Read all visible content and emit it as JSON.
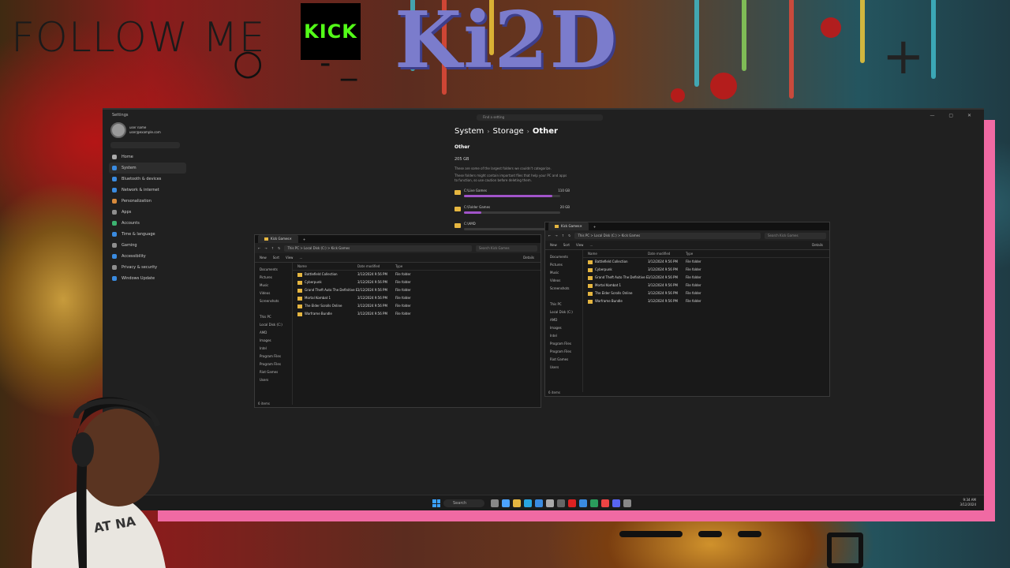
{
  "overlay": {
    "follow_text": "FOLLOW ME",
    "kick_text": "KICK",
    "logo_text": "Ki2D",
    "brand_color": "#53fc18",
    "frame_color": "#f06aa3"
  },
  "settings": {
    "window_title": "Settings",
    "search_placeholder": "Find a setting",
    "account": {
      "name": "user name",
      "email": "user@example.com"
    },
    "nav": [
      {
        "label": "Home",
        "icon": "home-icon",
        "color": "#aaa"
      },
      {
        "label": "System",
        "icon": "monitor-icon",
        "color": "#3a8be0",
        "selected": true
      },
      {
        "label": "Bluetooth & devices",
        "icon": "bluetooth-icon",
        "color": "#3a8be0"
      },
      {
        "label": "Network & internet",
        "icon": "wifi-icon",
        "color": "#3a8be0"
      },
      {
        "label": "Personalization",
        "icon": "brush-icon",
        "color": "#d88a3b"
      },
      {
        "label": "Apps",
        "icon": "apps-icon",
        "color": "#8e8e8e"
      },
      {
        "label": "Accounts",
        "icon": "person-icon",
        "color": "#3cb371"
      },
      {
        "label": "Time & language",
        "icon": "globe-icon",
        "color": "#3a8be0"
      },
      {
        "label": "Gaming",
        "icon": "controller-icon",
        "color": "#8e8e8e"
      },
      {
        "label": "Accessibility",
        "icon": "accessibility-icon",
        "color": "#3a8be0"
      },
      {
        "label": "Privacy & security",
        "icon": "shield-icon",
        "color": "#8e8e8e"
      },
      {
        "label": "Windows Update",
        "icon": "update-icon",
        "color": "#3a8be0"
      }
    ],
    "breadcrumb": {
      "a": "System",
      "b": "Storage",
      "c": "Other"
    },
    "section_title": "Other",
    "total_size": "205 GB",
    "desc1": "These are some of the largest folders we couldn't categorize.",
    "desc2": "These folders might contain important files that help your PC and apps",
    "desc3": "to function, so use caution before deleting them.",
    "rows": [
      {
        "name": "C:\\Live Games",
        "size": "110 GB",
        "fill": 0.92
      },
      {
        "name": "C:\\Folder Games",
        "size": "20 GB",
        "fill": 0.18
      },
      {
        "name": "C:\\AMD",
        "size": "",
        "fill": 0
      }
    ]
  },
  "explorer_left": {
    "tab_title": "Kick Games",
    "address": "This PC  >  Local Disk (C:)  >  Kick Games",
    "search": "Search Kick Games",
    "cmd": [
      "New",
      "Sort",
      "View",
      "..."
    ],
    "details": "Details",
    "nav": [
      "Documents",
      "Pictures",
      "Music",
      "Videos",
      "Screenshots",
      "",
      "This PC",
      "Local Disk (C:)",
      "AMD",
      "Images",
      "Intel",
      "Program Files",
      "Program Files",
      "Riot Games",
      "Users"
    ],
    "headers": [
      "Name",
      "Date modified",
      "Type"
    ],
    "files": [
      {
        "name": "Battlefield Collection",
        "date": "3/12/2024 9:56 PM",
        "type": "File folder"
      },
      {
        "name": "Cyberpunk",
        "date": "3/12/2024 9:56 PM",
        "type": "File folder"
      },
      {
        "name": "Grand Theft Auto The Definitive Edition",
        "date": "3/12/2024 9:56 PM",
        "type": "File folder"
      },
      {
        "name": "Mortal Kombat 1",
        "date": "3/12/2024 9:56 PM",
        "type": "File folder"
      },
      {
        "name": "The Elder Scrolls Online",
        "date": "3/12/2024 9:56 PM",
        "type": "File folder"
      },
      {
        "name": "Warframe Bundle",
        "date": "3/12/2024 9:56 PM",
        "type": "File folder"
      }
    ],
    "status": "6 items"
  },
  "explorer_right": {
    "tab_title": "Kick Games",
    "address": "This PC  >  Local Disk (C:)  >  Kick Games",
    "search": "Search Kick Games",
    "cmd": [
      "New",
      "Sort",
      "View",
      "..."
    ],
    "details": "Details",
    "nav": [
      "Documents",
      "Pictures",
      "Music",
      "Videos",
      "Screenshots",
      "",
      "This PC",
      "Local Disk (C:)",
      "AMD",
      "Images",
      "Intel",
      "Program Files",
      "Program Files",
      "Riot Games",
      "Users"
    ],
    "headers": [
      "Name",
      "Date modified",
      "Type"
    ],
    "files": [
      {
        "name": "Battlefield Collection",
        "date": "3/12/2024 9:56 PM",
        "type": "File folder"
      },
      {
        "name": "Cyberpunk",
        "date": "3/12/2024 9:56 PM",
        "type": "File folder"
      },
      {
        "name": "Grand Theft Auto The Definitive Edition",
        "date": "3/12/2024 9:56 PM",
        "type": "File folder"
      },
      {
        "name": "Mortal Kombat 1",
        "date": "3/12/2024 9:56 PM",
        "type": "File folder"
      },
      {
        "name": "The Elder Scrolls Online",
        "date": "3/12/2024 9:56 PM",
        "type": "File folder"
      },
      {
        "name": "Warframe Bundle",
        "date": "3/12/2024 9:56 PM",
        "type": "File folder"
      }
    ],
    "status": "6 items"
  },
  "taskbar": {
    "search_label": "Search",
    "time": "9:34 AM",
    "date": "3/12/2024",
    "icons": [
      {
        "name": "task-view-icon",
        "color": "#888"
      },
      {
        "name": "widgets-icon",
        "color": "#4ca3ff"
      },
      {
        "name": "file-explorer-icon",
        "color": "#e6b640"
      },
      {
        "name": "edge-icon",
        "color": "#29a5e0"
      },
      {
        "name": "store-icon",
        "color": "#3a8be0"
      },
      {
        "name": "settings-icon",
        "color": "#aaa"
      },
      {
        "name": "terminal-icon",
        "color": "#666"
      },
      {
        "name": "app-red-icon",
        "color": "#d22"
      },
      {
        "name": "app-blue-icon",
        "color": "#3a8be0"
      },
      {
        "name": "app-green-icon",
        "color": "#2a9d5c"
      },
      {
        "name": "chrome-icon",
        "color": "#e44"
      },
      {
        "name": "discord-icon",
        "color": "#5865f2"
      },
      {
        "name": "obs-icon",
        "color": "#888"
      }
    ]
  }
}
